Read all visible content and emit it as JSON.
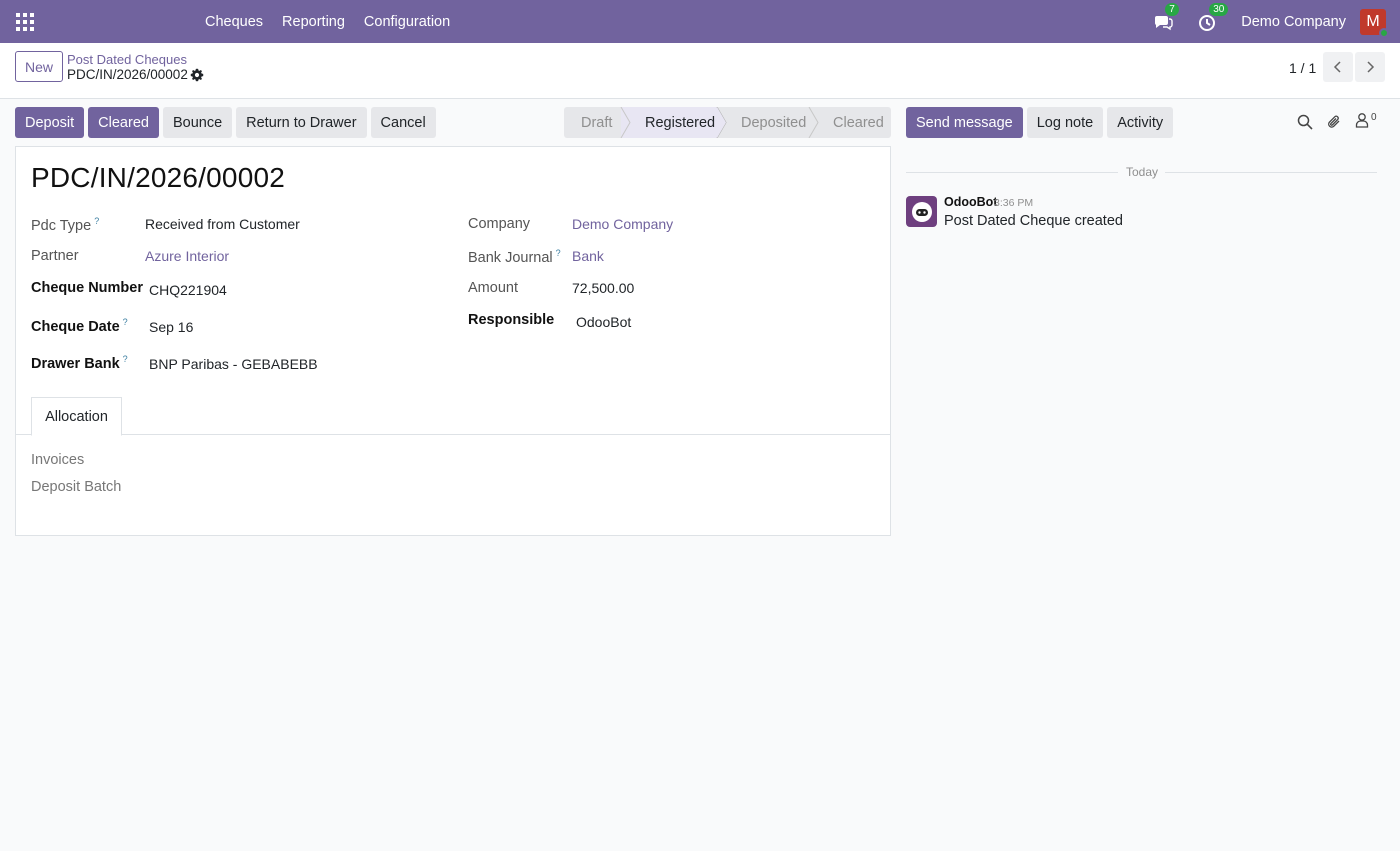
{
  "topbar": {
    "menu": [
      "Cheques",
      "Reporting",
      "Configuration"
    ],
    "messages_badge": "7",
    "activities_badge": "30",
    "company": "Demo Company",
    "avatar_letter": "M"
  },
  "control": {
    "new_label": "New",
    "breadcrumb": "Post Dated Cheques",
    "record": "PDC/IN/2026/00002",
    "pager": "1 / 1"
  },
  "actions": [
    "Deposit",
    "Cleared",
    "Bounce",
    "Return to Drawer",
    "Cancel"
  ],
  "status": {
    "stages": [
      "Draft",
      "Registered",
      "Deposited",
      "Cleared"
    ],
    "active": "Registered"
  },
  "form": {
    "title": "PDC/IN/2026/00002",
    "left": {
      "pdc_type_label": "Pdc Type",
      "pdc_type": "Received from Customer",
      "partner_label": "Partner",
      "partner": "Azure Interior",
      "cheque_number_label": "Cheque Number",
      "cheque_number": "CHQ221904",
      "cheque_date_label": "Cheque Date",
      "cheque_date": "Sep 16",
      "drawer_bank_label": "Drawer Bank",
      "drawer_bank": "BNP Paribas - GEBABEBB"
    },
    "right": {
      "company_label": "Company",
      "company": "Demo Company",
      "bank_journal_label": "Bank Journal",
      "bank_journal": "Bank",
      "amount_label": "Amount",
      "amount": "72,500.00",
      "responsible_label": "Responsible",
      "responsible": "OdooBot"
    },
    "help_mark": "?",
    "tab": "Allocation",
    "allocation": {
      "invoices_label": "Invoices",
      "deposit_batch_label": "Deposit Batch"
    }
  },
  "chatter": {
    "send_message": "Send message",
    "log_note": "Log note",
    "activity": "Activity",
    "followers_count": "0",
    "day_separator": "Today",
    "message": {
      "author": "OdooBot",
      "time": "3:36 PM",
      "body": "Post Dated Cheque created"
    }
  },
  "colors": {
    "brand": "#71639e",
    "badge": "#28a745",
    "avatar": "#c0392b"
  }
}
